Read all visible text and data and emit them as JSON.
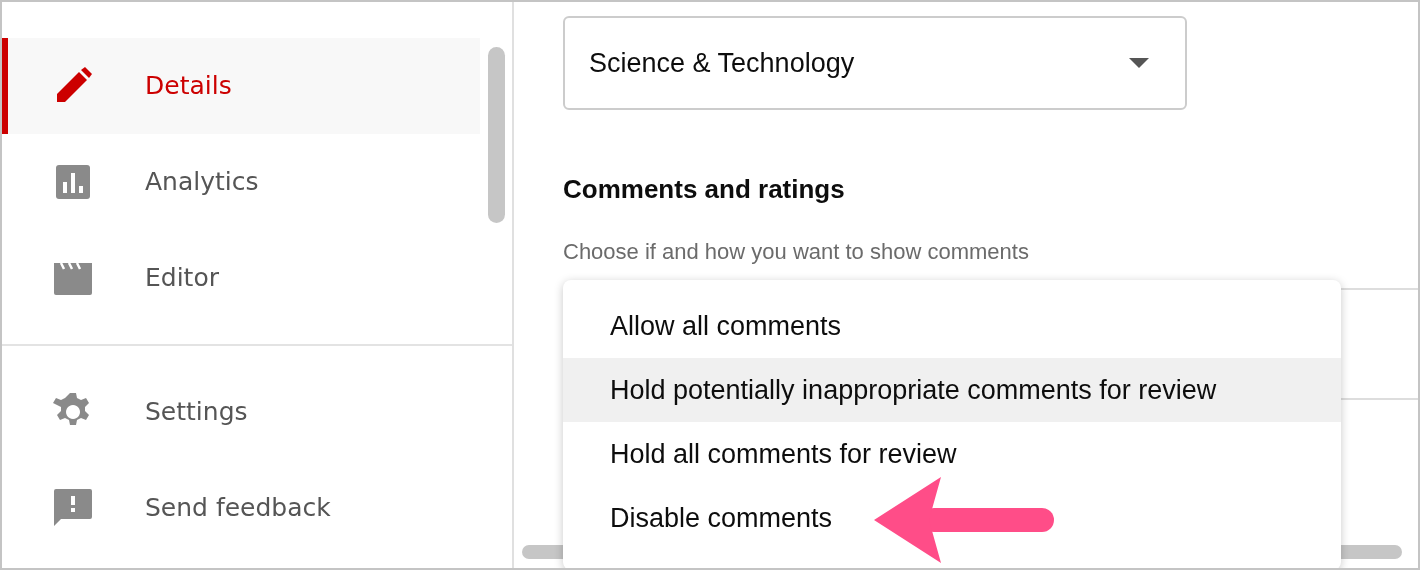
{
  "sidebar": {
    "items": [
      {
        "label": "Details",
        "selected": true
      },
      {
        "label": "Analytics",
        "selected": false
      },
      {
        "label": "Editor",
        "selected": false
      }
    ],
    "footer_items": [
      {
        "label": "Settings"
      },
      {
        "label": "Send feedback"
      }
    ]
  },
  "category": {
    "value": "Science & Technology"
  },
  "comments": {
    "heading": "Comments and ratings",
    "description": "Choose if and how you want to show comments",
    "options": [
      {
        "label": "Allow all comments",
        "selected": false
      },
      {
        "label": "Hold potentially inappropriate comments for review",
        "selected": true
      },
      {
        "label": "Hold all comments for review",
        "selected": false
      },
      {
        "label": "Disable comments",
        "selected": false
      }
    ]
  }
}
